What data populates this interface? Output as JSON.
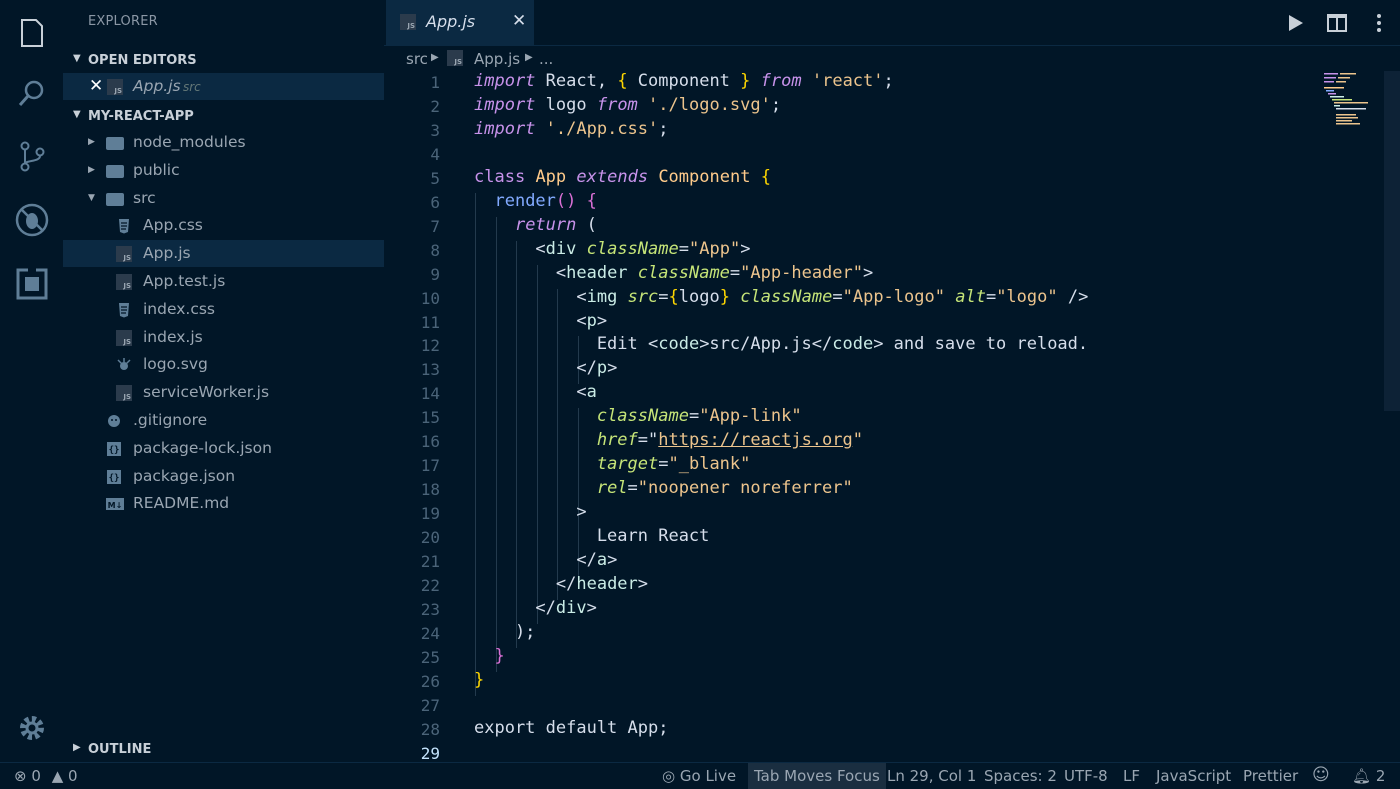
{
  "explorer": {
    "title": "EXPLORER",
    "open_editors": {
      "label": "OPEN EDITORS",
      "items": [
        {
          "name": "App.js",
          "path": "src"
        }
      ]
    },
    "project": {
      "label": "MY-REACT-APP",
      "tree": [
        {
          "name": "node_modules",
          "kind": "folder"
        },
        {
          "name": "public",
          "kind": "folder"
        },
        {
          "name": "src",
          "kind": "folder-open"
        },
        {
          "name": "App.css",
          "kind": "css"
        },
        {
          "name": "App.js",
          "kind": "js"
        },
        {
          "name": "App.test.js",
          "kind": "js"
        },
        {
          "name": "index.css",
          "kind": "css"
        },
        {
          "name": "index.js",
          "kind": "js"
        },
        {
          "name": "logo.svg",
          "kind": "svg"
        },
        {
          "name": "serviceWorker.js",
          "kind": "js"
        },
        {
          "name": ".gitignore",
          "kind": "git"
        },
        {
          "name": "package-lock.json",
          "kind": "json"
        },
        {
          "name": "package.json",
          "kind": "json"
        },
        {
          "name": "README.md",
          "kind": "md"
        }
      ]
    },
    "outline_label": "OUTLINE"
  },
  "tab": {
    "name": "App.js",
    "close": "✕",
    "icon_text": "JS"
  },
  "breadcrumbs": {
    "folder": "src",
    "file": "App.js",
    "more": "..."
  },
  "editor": {
    "line_numbers": [
      "1",
      "2",
      "3",
      "4",
      "5",
      "6",
      "7",
      "8",
      "9",
      "10",
      "11",
      "12",
      "13",
      "14",
      "15",
      "16",
      "17",
      "18",
      "19",
      "20",
      "21",
      "22",
      "23",
      "24",
      "25",
      "26",
      "27",
      "28",
      "29"
    ],
    "lines": [
      [
        [
          "import",
          "k-it"
        ],
        [
          " React, ",
          ""
        ],
        [
          "{",
          "b1"
        ],
        [
          " Component ",
          ""
        ],
        [
          "}",
          "b1"
        ],
        [
          " ",
          ""
        ],
        [
          "from",
          "k-it"
        ],
        [
          " ",
          ""
        ],
        [
          "'react'",
          "s"
        ],
        [
          ";",
          ""
        ]
      ],
      [
        [
          "import",
          "k-it"
        ],
        [
          " logo ",
          ""
        ],
        [
          "from",
          "k-it"
        ],
        [
          " ",
          ""
        ],
        [
          "'./logo.svg'",
          "s"
        ],
        [
          ";",
          ""
        ]
      ],
      [
        [
          "import",
          "k-it"
        ],
        [
          " ",
          ""
        ],
        [
          "'./App.css'",
          "s"
        ],
        [
          ";",
          ""
        ]
      ],
      [],
      [
        [
          "class",
          "k"
        ],
        [
          " ",
          ""
        ],
        [
          "App",
          "c"
        ],
        [
          " ",
          ""
        ],
        [
          "extends",
          "k-it"
        ],
        [
          " ",
          ""
        ],
        [
          "Component",
          "c"
        ],
        [
          " ",
          ""
        ],
        [
          "{",
          "b1"
        ]
      ],
      [
        [
          "  ",
          ""
        ],
        [
          "render",
          "f"
        ],
        [
          "()",
          "b2"
        ],
        [
          " ",
          ""
        ],
        [
          "{",
          "b2"
        ]
      ],
      [
        [
          "    ",
          ""
        ],
        [
          "return",
          "k-it"
        ],
        [
          " (",
          ""
        ]
      ],
      [
        [
          "      <",
          ""
        ],
        [
          "div",
          "t"
        ],
        [
          " ",
          ""
        ],
        [
          "className",
          "a"
        ],
        [
          "=",
          ""
        ],
        [
          "\"App\"",
          "s"
        ],
        [
          ">",
          ""
        ]
      ],
      [
        [
          "        <",
          ""
        ],
        [
          "header",
          "t"
        ],
        [
          " ",
          ""
        ],
        [
          "className",
          "a"
        ],
        [
          "=",
          ""
        ],
        [
          "\"App-header\"",
          "s"
        ],
        [
          ">",
          ""
        ]
      ],
      [
        [
          "          <",
          ""
        ],
        [
          "img",
          "t"
        ],
        [
          " ",
          ""
        ],
        [
          "src",
          "a"
        ],
        [
          "=",
          ""
        ],
        [
          "{",
          "b1"
        ],
        [
          "logo",
          ""
        ],
        [
          "}",
          "b1"
        ],
        [
          " ",
          ""
        ],
        [
          "className",
          "a"
        ],
        [
          "=",
          ""
        ],
        [
          "\"App-logo\"",
          "s"
        ],
        [
          " ",
          ""
        ],
        [
          "alt",
          "a"
        ],
        [
          "=",
          ""
        ],
        [
          "\"logo\"",
          "s"
        ],
        [
          " />",
          ""
        ]
      ],
      [
        [
          "          <",
          ""
        ],
        [
          "p",
          "t"
        ],
        [
          ">",
          ""
        ]
      ],
      [
        [
          "            Edit <",
          ""
        ],
        [
          "code",
          "t"
        ],
        [
          ">src/App.js</",
          ""
        ],
        [
          "code",
          "t"
        ],
        [
          "> and save to reload.",
          ""
        ]
      ],
      [
        [
          "          </",
          ""
        ],
        [
          "p",
          "t"
        ],
        [
          ">",
          ""
        ]
      ],
      [
        [
          "          <",
          ""
        ],
        [
          "a",
          "t"
        ]
      ],
      [
        [
          "            ",
          ""
        ],
        [
          "className",
          "a"
        ],
        [
          "=",
          ""
        ],
        [
          "\"App-link\"",
          "s"
        ]
      ],
      [
        [
          "            ",
          ""
        ],
        [
          "href",
          "a"
        ],
        [
          "=",
          ""
        ],
        [
          "\"",
          ""
        ],
        [
          "https://reactjs.org",
          "s u"
        ],
        [
          "\"",
          "s"
        ]
      ],
      [
        [
          "            ",
          ""
        ],
        [
          "target",
          "a"
        ],
        [
          "=",
          ""
        ],
        [
          "\"_blank\"",
          "s"
        ]
      ],
      [
        [
          "            ",
          ""
        ],
        [
          "rel",
          "a"
        ],
        [
          "=",
          ""
        ],
        [
          "\"noopener noreferrer\"",
          "s"
        ]
      ],
      [
        [
          "          >",
          ""
        ]
      ],
      [
        [
          "            Learn React",
          ""
        ]
      ],
      [
        [
          "          </",
          ""
        ],
        [
          "a",
          "t"
        ],
        [
          ">",
          ""
        ]
      ],
      [
        [
          "        </",
          ""
        ],
        [
          "header",
          "t"
        ],
        [
          ">",
          ""
        ]
      ],
      [
        [
          "      </",
          ""
        ],
        [
          "div",
          "t"
        ],
        [
          ">",
          ""
        ]
      ],
      [
        [
          "    );",
          ""
        ]
      ],
      [
        [
          "  ",
          ""
        ],
        [
          "}",
          "b2"
        ]
      ],
      [
        [
          "}",
          "b1"
        ]
      ],
      [],
      [
        [
          "export default App;",
          ""
        ]
      ],
      []
    ]
  },
  "status": {
    "errors": "0",
    "warnings": "0",
    "go_live": "Go Live",
    "tab_focus": "Tab Moves Focus",
    "position": "Ln 29, Col 1",
    "spaces": "Spaces: 2",
    "encoding": "UTF-8",
    "eol": "LF",
    "language": "JavaScript",
    "formatter": "Prettier",
    "notifications": "2"
  },
  "colors": {
    "background": "#011627",
    "selection": "#0b2942",
    "accent": "#c792ea"
  }
}
